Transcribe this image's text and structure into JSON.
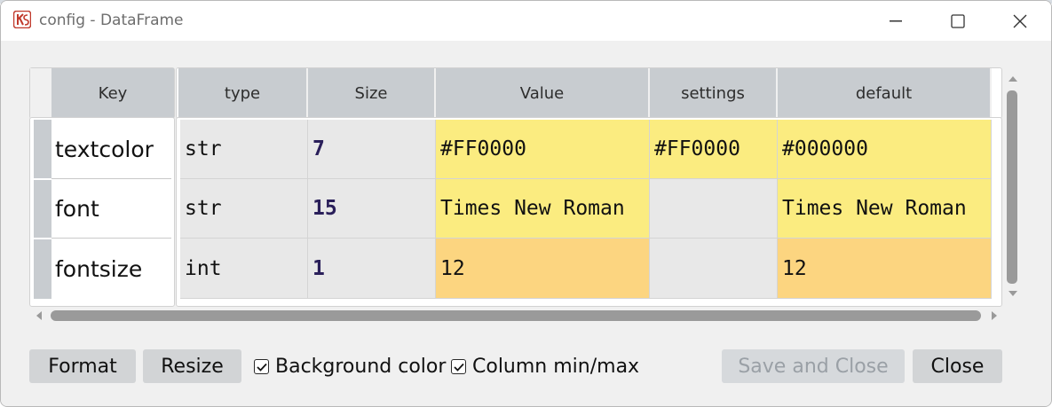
{
  "window": {
    "title": "config - DataFrame"
  },
  "table": {
    "index_header": "Key",
    "columns": [
      "type",
      "Size",
      "Value",
      "settings",
      "default"
    ],
    "rows": [
      {
        "key": "textcolor",
        "type": "str",
        "size": "7",
        "value": "#FF0000",
        "settings": "#FF0000",
        "default": "#000000"
      },
      {
        "key": "font",
        "type": "str",
        "size": "15",
        "value": "Times New Roman",
        "settings": "",
        "default": "Times New Roman"
      },
      {
        "key": "fontsize",
        "type": "int",
        "size": "1",
        "value": "12",
        "settings": "",
        "default": "12"
      }
    ]
  },
  "colors": {
    "highlight_yellow": "#fbec80",
    "highlight_orange": "#fcd580",
    "header_gray": "#c8ccd0",
    "cell_gray": "#e8e8e8"
  },
  "bottom_bar": {
    "format_label": "Format",
    "resize_label": "Resize",
    "background_color_label": "Background color",
    "background_color_checked": true,
    "column_minmax_label": "Column min/max",
    "column_minmax_checked": true,
    "save_close_label": "Save and Close",
    "close_label": "Close"
  }
}
